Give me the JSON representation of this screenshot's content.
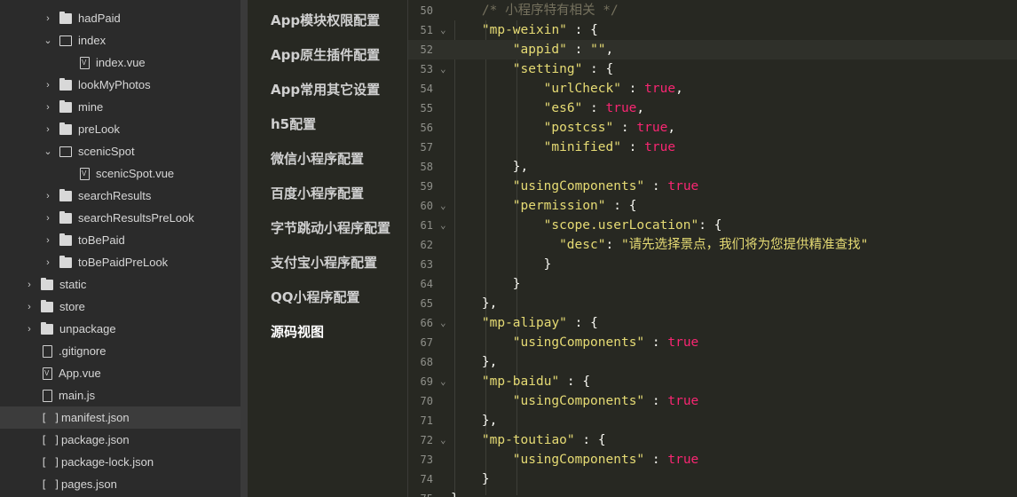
{
  "sidebar": {
    "items": [
      {
        "label": "hadPaid",
        "kind": "folder",
        "chev": "›",
        "indent": 1
      },
      {
        "label": "index",
        "kind": "folder-open",
        "chev": "⌄",
        "indent": 1
      },
      {
        "label": "index.vue",
        "kind": "vue",
        "chev": "",
        "indent": 2
      },
      {
        "label": "lookMyPhotos",
        "kind": "folder",
        "chev": "›",
        "indent": 1
      },
      {
        "label": "mine",
        "kind": "folder",
        "chev": "›",
        "indent": 1
      },
      {
        "label": "preLook",
        "kind": "folder",
        "chev": "›",
        "indent": 1
      },
      {
        "label": "scenicSpot",
        "kind": "folder-open",
        "chev": "⌄",
        "indent": 1
      },
      {
        "label": "scenicSpot.vue",
        "kind": "vue",
        "chev": "",
        "indent": 2
      },
      {
        "label": "searchResults",
        "kind": "folder",
        "chev": "›",
        "indent": 1
      },
      {
        "label": "searchResultsPreLook",
        "kind": "folder",
        "chev": "›",
        "indent": 1
      },
      {
        "label": "toBePaid",
        "kind": "folder",
        "chev": "›",
        "indent": 1
      },
      {
        "label": "toBePaidPreLook",
        "kind": "folder",
        "chev": "›",
        "indent": 1
      },
      {
        "label": "static",
        "kind": "folder",
        "chev": "›",
        "indent": 0
      },
      {
        "label": "store",
        "kind": "folder",
        "chev": "›",
        "indent": 0
      },
      {
        "label": "unpackage",
        "kind": "folder",
        "chev": "›",
        "indent": 0
      },
      {
        "label": ".gitignore",
        "kind": "file",
        "chev": "",
        "indent": 0
      },
      {
        "label": "App.vue",
        "kind": "vue",
        "chev": "",
        "indent": 0
      },
      {
        "label": "main.js",
        "kind": "file",
        "chev": "",
        "indent": 0
      },
      {
        "label": "manifest.json",
        "kind": "json",
        "chev": "",
        "indent": 0,
        "selected": true
      },
      {
        "label": "package.json",
        "kind": "json",
        "chev": "",
        "indent": 0
      },
      {
        "label": "package-lock.json",
        "kind": "json",
        "chev": "",
        "indent": 0
      },
      {
        "label": "pages.json",
        "kind": "json",
        "chev": "",
        "indent": 0
      }
    ]
  },
  "menu": {
    "items": [
      {
        "label": "App模块权限配置"
      },
      {
        "label": "App原生插件配置"
      },
      {
        "label": "App常用其它设置"
      },
      {
        "label": "h5配置"
      },
      {
        "label": "微信小程序配置"
      },
      {
        "label": "百度小程序配置"
      },
      {
        "label": "字节跳动小程序配置"
      },
      {
        "label": "支付宝小程序配置"
      },
      {
        "label": "QQ小程序配置"
      },
      {
        "label": "源码视图",
        "active": true
      }
    ]
  },
  "editor": {
    "lines": [
      {
        "n": "50",
        "fold": "",
        "indent": 1,
        "tokens": [
          [
            "c",
            "/* 小程序特有相关 */"
          ]
        ]
      },
      {
        "n": "51",
        "fold": "⌄",
        "indent": 1,
        "tokens": [
          [
            "s",
            "\"mp-weixin\""
          ],
          [
            "p",
            " : {"
          ]
        ]
      },
      {
        "n": "52",
        "fold": "",
        "indent": 2,
        "current": true,
        "tokens": [
          [
            "s",
            "\"appid\""
          ],
          [
            "p",
            " : "
          ],
          [
            "s",
            "\"\""
          ],
          [
            "p",
            ","
          ]
        ]
      },
      {
        "n": "53",
        "fold": "⌄",
        "indent": 2,
        "tokens": [
          [
            "s",
            "\"setting\""
          ],
          [
            "p",
            " : {"
          ]
        ]
      },
      {
        "n": "54",
        "fold": "",
        "indent": 3,
        "tokens": [
          [
            "s",
            "\"urlCheck\""
          ],
          [
            "p",
            " : "
          ],
          [
            "t",
            "true"
          ],
          [
            "p",
            ","
          ]
        ]
      },
      {
        "n": "55",
        "fold": "",
        "indent": 3,
        "tokens": [
          [
            "s",
            "\"es6\""
          ],
          [
            "p",
            " : "
          ],
          [
            "t",
            "true"
          ],
          [
            "p",
            ","
          ]
        ]
      },
      {
        "n": "56",
        "fold": "",
        "indent": 3,
        "tokens": [
          [
            "s",
            "\"postcss\""
          ],
          [
            "p",
            " : "
          ],
          [
            "t",
            "true"
          ],
          [
            "p",
            ","
          ]
        ]
      },
      {
        "n": "57",
        "fold": "",
        "indent": 3,
        "tokens": [
          [
            "s",
            "\"minified\""
          ],
          [
            "p",
            " : "
          ],
          [
            "t",
            "true"
          ]
        ]
      },
      {
        "n": "58",
        "fold": "",
        "indent": 2,
        "tokens": [
          [
            "p",
            "},"
          ]
        ]
      },
      {
        "n": "59",
        "fold": "",
        "indent": 2,
        "tokens": [
          [
            "s",
            "\"usingComponents\""
          ],
          [
            "p",
            " : "
          ],
          [
            "t",
            "true"
          ]
        ]
      },
      {
        "n": "60",
        "fold": "⌄",
        "indent": 2,
        "tokens": [
          [
            "s",
            "\"permission\""
          ],
          [
            "p",
            " : {"
          ]
        ]
      },
      {
        "n": "61",
        "fold": "⌄",
        "indent": 3,
        "tokens": [
          [
            "s",
            "\"scope.userLocation\""
          ],
          [
            "p",
            ": {"
          ]
        ]
      },
      {
        "n": "62",
        "fold": "",
        "indent": 3.5,
        "tokens": [
          [
            "s",
            "\"desc\""
          ],
          [
            "p",
            ": "
          ],
          [
            "s",
            "\"请先选择景点，我们将为您提供精准查找\""
          ]
        ]
      },
      {
        "n": "63",
        "fold": "",
        "indent": 3,
        "tokens": [
          [
            "p",
            "}"
          ]
        ]
      },
      {
        "n": "64",
        "fold": "",
        "indent": 2,
        "tokens": [
          [
            "p",
            "}"
          ]
        ]
      },
      {
        "n": "65",
        "fold": "",
        "indent": 1,
        "tokens": [
          [
            "p",
            "},"
          ]
        ]
      },
      {
        "n": "66",
        "fold": "⌄",
        "indent": 1,
        "tokens": [
          [
            "s",
            "\"mp-alipay\""
          ],
          [
            "p",
            " : {"
          ]
        ]
      },
      {
        "n": "67",
        "fold": "",
        "indent": 2,
        "tokens": [
          [
            "s",
            "\"usingComponents\""
          ],
          [
            "p",
            " : "
          ],
          [
            "t",
            "true"
          ]
        ]
      },
      {
        "n": "68",
        "fold": "",
        "indent": 1,
        "tokens": [
          [
            "p",
            "},"
          ]
        ]
      },
      {
        "n": "69",
        "fold": "⌄",
        "indent": 1,
        "tokens": [
          [
            "s",
            "\"mp-baidu\""
          ],
          [
            "p",
            " : {"
          ]
        ]
      },
      {
        "n": "70",
        "fold": "",
        "indent": 2,
        "tokens": [
          [
            "s",
            "\"usingComponents\""
          ],
          [
            "p",
            " : "
          ],
          [
            "t",
            "true"
          ]
        ]
      },
      {
        "n": "71",
        "fold": "",
        "indent": 1,
        "tokens": [
          [
            "p",
            "},"
          ]
        ]
      },
      {
        "n": "72",
        "fold": "⌄",
        "indent": 1,
        "tokens": [
          [
            "s",
            "\"mp-toutiao\""
          ],
          [
            "p",
            " : {"
          ]
        ]
      },
      {
        "n": "73",
        "fold": "",
        "indent": 2,
        "tokens": [
          [
            "s",
            "\"usingComponents\""
          ],
          [
            "p",
            " : "
          ],
          [
            "t",
            "true"
          ]
        ]
      },
      {
        "n": "74",
        "fold": "",
        "indent": 1,
        "tokens": [
          [
            "p",
            "}"
          ]
        ]
      },
      {
        "n": "75",
        "fold": "",
        "indent": 0,
        "tokens": [
          [
            "p",
            "}"
          ]
        ]
      }
    ]
  }
}
